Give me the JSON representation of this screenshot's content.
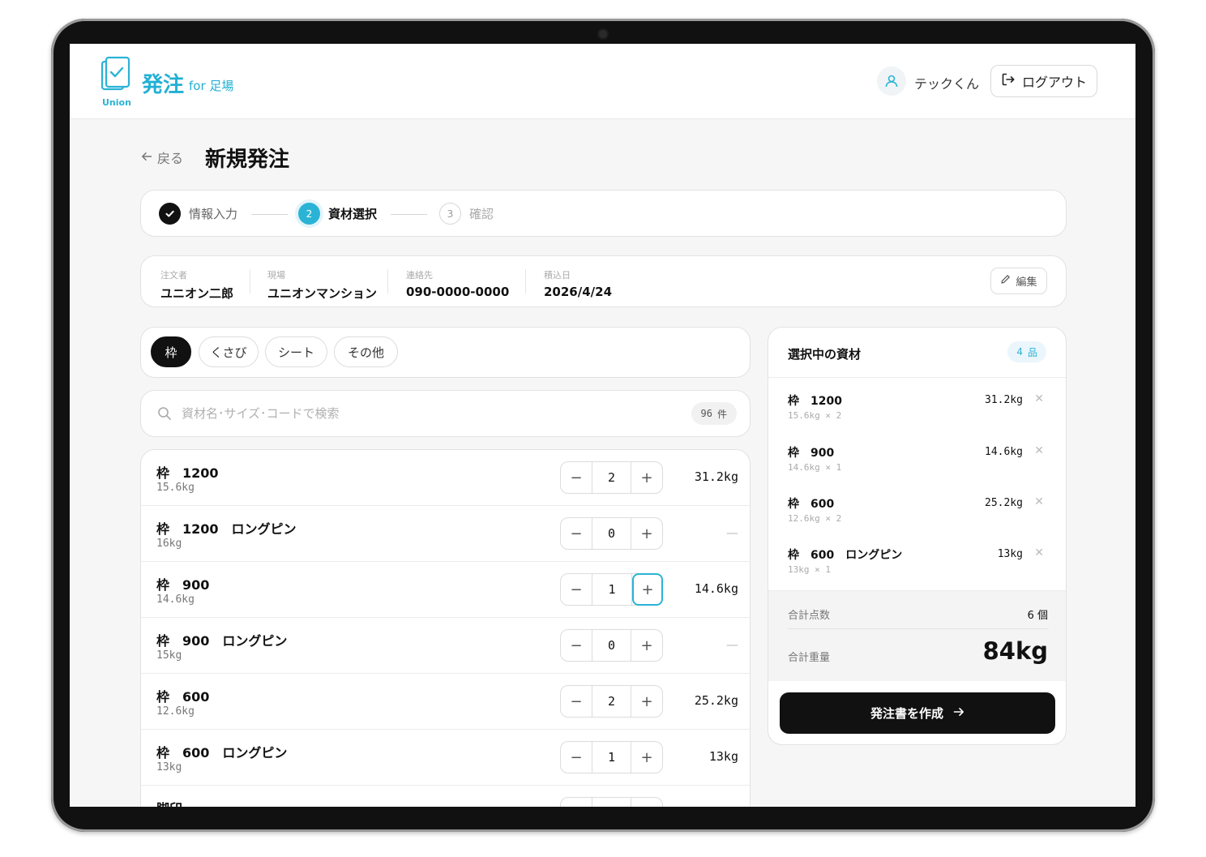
{
  "header": {
    "app_title": "発注",
    "app_subtitle": "for 足場",
    "brand_wordmark": "Union",
    "user_name": "テックくん",
    "logout_label": "ログアウト"
  },
  "page": {
    "back_label": "戻る",
    "title": "新規発注"
  },
  "steps": [
    {
      "label": "情報入力",
      "state": "done"
    },
    {
      "number": "2",
      "label": "資材選択",
      "state": "current"
    },
    {
      "number": "3",
      "label": "確認",
      "state": "pending"
    }
  ],
  "order_info": {
    "orderer_label": "注文者",
    "orderer": "ユニオン二郎",
    "site_label": "現場",
    "site": "ユニオンマンション",
    "contact_label": "連絡先",
    "contact": "090-0000-0000",
    "date_label": "積込日",
    "date": "2026/4/24",
    "edit_label": "編集"
  },
  "categories": [
    {
      "label": "枠",
      "active": true
    },
    {
      "label": "くさび",
      "active": false
    },
    {
      "label": "シート",
      "active": false
    },
    {
      "label": "その他",
      "active": false
    }
  ],
  "search": {
    "placeholder": "資材名･サイズ･コードで検索",
    "count": "96",
    "count_unit": "件"
  },
  "products": [
    {
      "name": "枠　1200",
      "unit_weight": "15.6kg",
      "qty": "2",
      "total": "31.2kg"
    },
    {
      "name": "枠　1200　ロングピン",
      "unit_weight": "16kg",
      "qty": "0",
      "total": "—"
    },
    {
      "name": "枠　900",
      "unit_weight": "14.6kg",
      "qty": "1",
      "total": "14.6kg"
    },
    {
      "name": "枠　900　ロングピン",
      "unit_weight": "15kg",
      "qty": "0",
      "total": "—"
    },
    {
      "name": "枠　600",
      "unit_weight": "12.6kg",
      "qty": "2",
      "total": "25.2kg"
    },
    {
      "name": "枠　600　ロングピン",
      "unit_weight": "13kg",
      "qty": "1",
      "total": "13kg"
    },
    {
      "name": "脚印",
      "unit_weight": "",
      "qty": "",
      "total": ""
    }
  ],
  "selected": {
    "title": "選択中の資材",
    "count": "4",
    "count_unit": "品",
    "items": [
      {
        "name": "枠　1200",
        "detail": "15.6kg × 2",
        "weight": "31.2kg"
      },
      {
        "name": "枠　900",
        "detail": "14.6kg × 1",
        "weight": "14.6kg"
      },
      {
        "name": "枠　600",
        "detail": "12.6kg × 2",
        "weight": "25.2kg"
      },
      {
        "name": "枠　600　ロングピン",
        "detail": "13kg × 1",
        "weight": "13kg"
      }
    ],
    "total_count_label": "合計点数",
    "total_count": "6 個",
    "total_weight_label": "合計重量",
    "total_weight": "84kg",
    "submit_label": "発注書を作成"
  },
  "colors": {
    "accent": "#2bb3d6",
    "dark": "#111111",
    "background": "#f6f6f6"
  }
}
